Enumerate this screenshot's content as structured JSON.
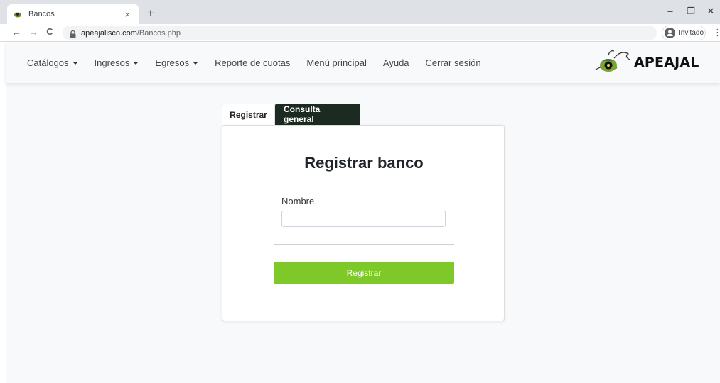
{
  "browser": {
    "tab_title": "Bancos",
    "new_tab": "+",
    "close_tab": "×",
    "url_host": "apeajalisco.com",
    "url_path": "/Bancos.php",
    "profile_label": "Invitado",
    "window_controls": {
      "minimize": "–",
      "restore": "❐",
      "close": "✕"
    },
    "nav": {
      "back": "←",
      "forward": "→",
      "reload": "C"
    },
    "menu": "⋮"
  },
  "navbar": {
    "items": [
      {
        "label": "Catálogos",
        "dropdown": true
      },
      {
        "label": "Ingresos",
        "dropdown": true
      },
      {
        "label": "Egresos",
        "dropdown": true
      },
      {
        "label": "Reporte de cuotas",
        "dropdown": false
      },
      {
        "label": "Menú principal",
        "dropdown": false
      },
      {
        "label": "Ayuda",
        "dropdown": false
      },
      {
        "label": "Cerrar sesión",
        "dropdown": false
      }
    ],
    "logo_text": "APEAJAL"
  },
  "tabs": {
    "register": "Registrar",
    "consult": "Consulta general"
  },
  "form": {
    "title": "Registrar banco",
    "name_label": "Nombre",
    "name_value": "",
    "name_placeholder": "",
    "submit_label": "Registrar"
  },
  "colors": {
    "accent_green": "#7ec82a",
    "dark_tab": "#1c2b21",
    "navbar_bg": "#f8f9fa"
  }
}
